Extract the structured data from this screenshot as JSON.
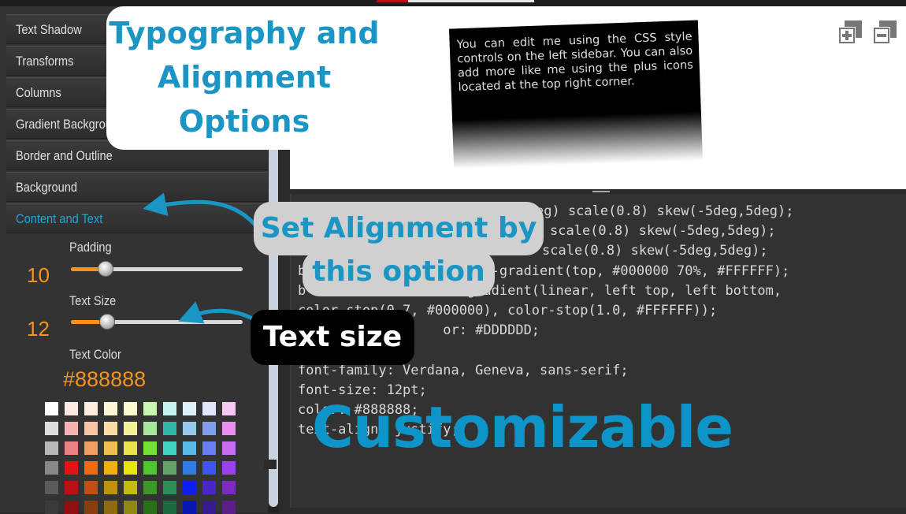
{
  "sidebar": {
    "items": [
      {
        "label": "Text Shadow"
      },
      {
        "label": "Transforms"
      },
      {
        "label": "Columns"
      },
      {
        "label": "Gradient Background"
      },
      {
        "label": "Border and Outline"
      },
      {
        "label": "Background"
      },
      {
        "label": "Content and Text",
        "active": true
      }
    ],
    "controls": {
      "padding": {
        "label": "Padding",
        "value": "10",
        "level": 0.2
      },
      "text_size": {
        "label": "Text Size",
        "value": "12",
        "level": 0.21
      },
      "text_color": {
        "label": "Text Color",
        "value": "#888888"
      }
    },
    "palette": [
      "#ffffff",
      "#ffe9e3",
      "#ffeedd",
      "#fff6d5",
      "#fffbd0",
      "#c8f7b2",
      "#c5f3ee",
      "#d9f1f7",
      "#e1e6fb",
      "#f5c9f1",
      "#dedede",
      "#f8b2b2",
      "#f9c6a4",
      "#f6dda4",
      "#f4f298",
      "#a5e89a",
      "#32b8a8",
      "#95c9ec",
      "#7f9ef0",
      "#ee8cf2",
      "#b8b8b8",
      "#ea8080",
      "#f29c61",
      "#eebe55",
      "#e9e34d",
      "#77e037",
      "#40d3c0",
      "#5ab9e6",
      "#6a7ef0",
      "#c86bf0",
      "#888888",
      "#e01515",
      "#f06a10",
      "#f0b012",
      "#e8e412",
      "#4fc52e",
      "#66a36a",
      "#2f7de4",
      "#3f55f0",
      "#9c42ea",
      "#5a5a5a",
      "#b81212",
      "#c14f12",
      "#c18f12",
      "#c1bb12",
      "#3b9a24",
      "#2d8f58",
      "#0c1ef0",
      "#4a27c4",
      "#7c2bbd",
      "#3a3a3a",
      "#8e1010",
      "#8e3b10",
      "#8e6b10",
      "#8e8a10",
      "#2b7018",
      "#1d6a40",
      "#0a16b0",
      "#351c90",
      "#5a1f8a"
    ]
  },
  "preview": {
    "text": "You can edit me using the CSS style controls on the left sidebar. You can also add more like me using the plus icons located at the top right corner.",
    "icons": [
      "add-box-icon",
      "remove-box-icon"
    ]
  },
  "code": {
    "lines": [
      "eg) scale(0.8) skew(-5deg,5deg);",
      "scale(0.8) skew(-5deg,5deg);",
      "scale(0.8) skew(-5deg,5deg);",
      "b                 linear-gradient(top, #000000 70%, #FFFFFF);",
      "b                 it-gradient(linear, left top, left bottom,",
      "color-stop(0.7, #000000), color-stop(1.0, #FFFFFF));",
      "                  or: #DDDDDD;",
      "",
      "font-family: Verdana, Geneva, sans-serif;",
      "font-size: 12pt;",
      "color: #888888;",
      "text-align: justify;"
    ]
  },
  "overlays": {
    "typography_title": "Typography and Alignment Options",
    "typography_lines": [
      "Typography and",
      "Alignment",
      "Options"
    ],
    "alignment_lines": [
      "Set Alignment by",
      "this option"
    ],
    "text_size_label": "Text size",
    "customizable": "Customizable"
  },
  "colors": {
    "accent_orange": "#f5931e",
    "accent_blue": "#1aa6d8",
    "overlay_blue": "#0d94c8"
  }
}
